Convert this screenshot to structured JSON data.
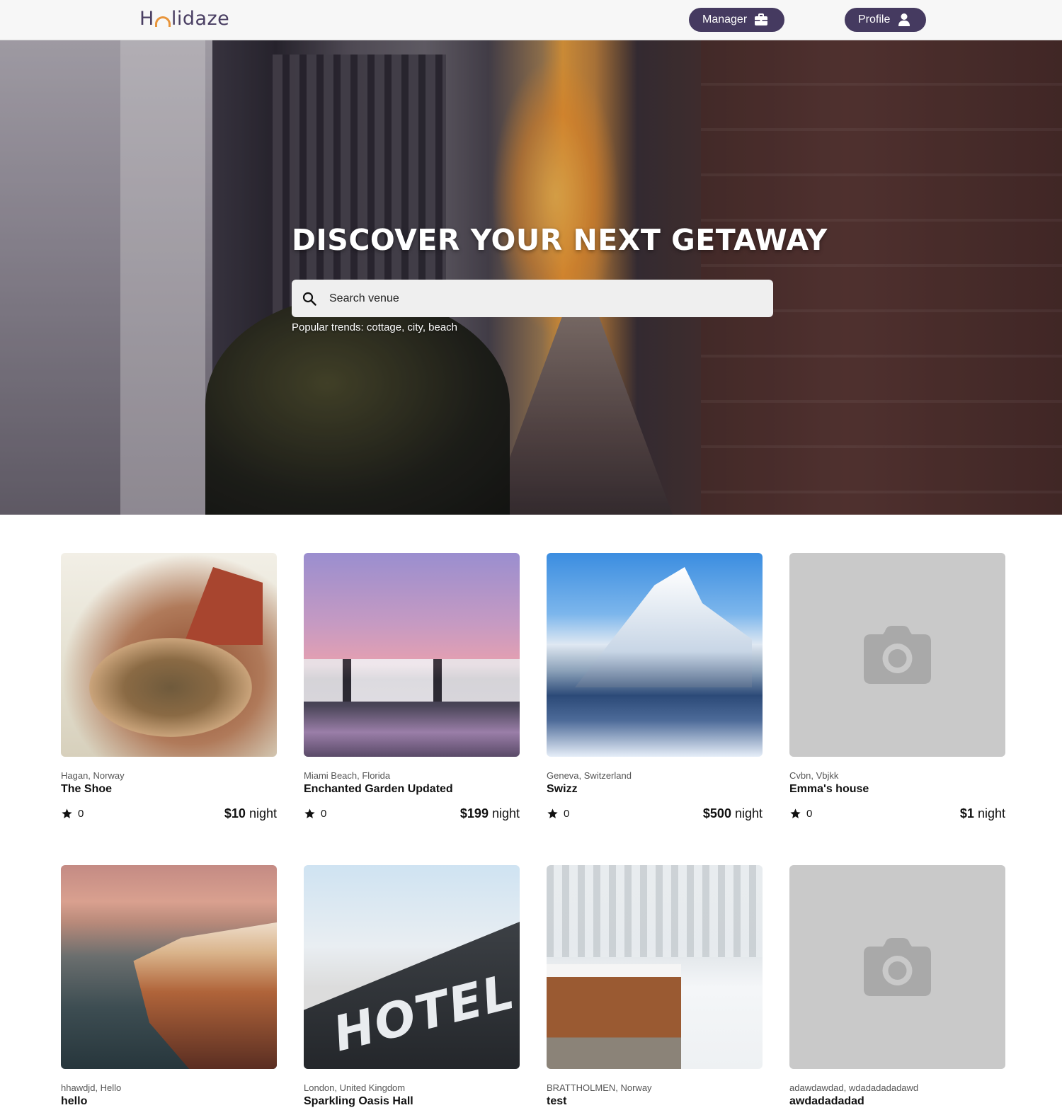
{
  "header": {
    "logo": "Holidaze",
    "manager_label": "Manager",
    "profile_label": "Profile"
  },
  "hero": {
    "title": "DISCOVER YOUR NEXT GETAWAY",
    "search_placeholder": "Search venue",
    "trends": "Popular trends: cottage, city, beach"
  },
  "venues": [
    {
      "location": "Hagan, Norway",
      "name": "The Shoe",
      "rating": "0",
      "price": "$10",
      "unit": " night"
    },
    {
      "location": "Miami Beach, Florida",
      "name": "Enchanted Garden Updated",
      "rating": "0",
      "price": "$199",
      "unit": " night"
    },
    {
      "location": "Geneva, Switzerland",
      "name": "Swizz",
      "rating": "0",
      "price": "$500",
      "unit": " night"
    },
    {
      "location": "Cvbn, Vbjkk",
      "name": "Emma's house",
      "rating": "0",
      "price": "$1",
      "unit": " night"
    },
    {
      "location": "hhawdjd, Hello",
      "name": "hello"
    },
    {
      "location": "London, United Kingdom",
      "name": "Sparkling Oasis Hall"
    },
    {
      "location": "BRATTHOLMEN, Norway",
      "name": "test"
    },
    {
      "location": "adawdawdad, wdadadadadawd",
      "name": "awdadadadad"
    }
  ],
  "icons": {
    "manager": "briefcase-icon",
    "profile": "user-icon",
    "search": "search-icon",
    "rating": "star-icon",
    "placeholder": "camera-icon"
  },
  "colors": {
    "nav_button": "#453a60",
    "logo_text": "#4a3f63",
    "logo_accent": "#e8953b",
    "placeholder_bg": "#c9c9c9"
  }
}
